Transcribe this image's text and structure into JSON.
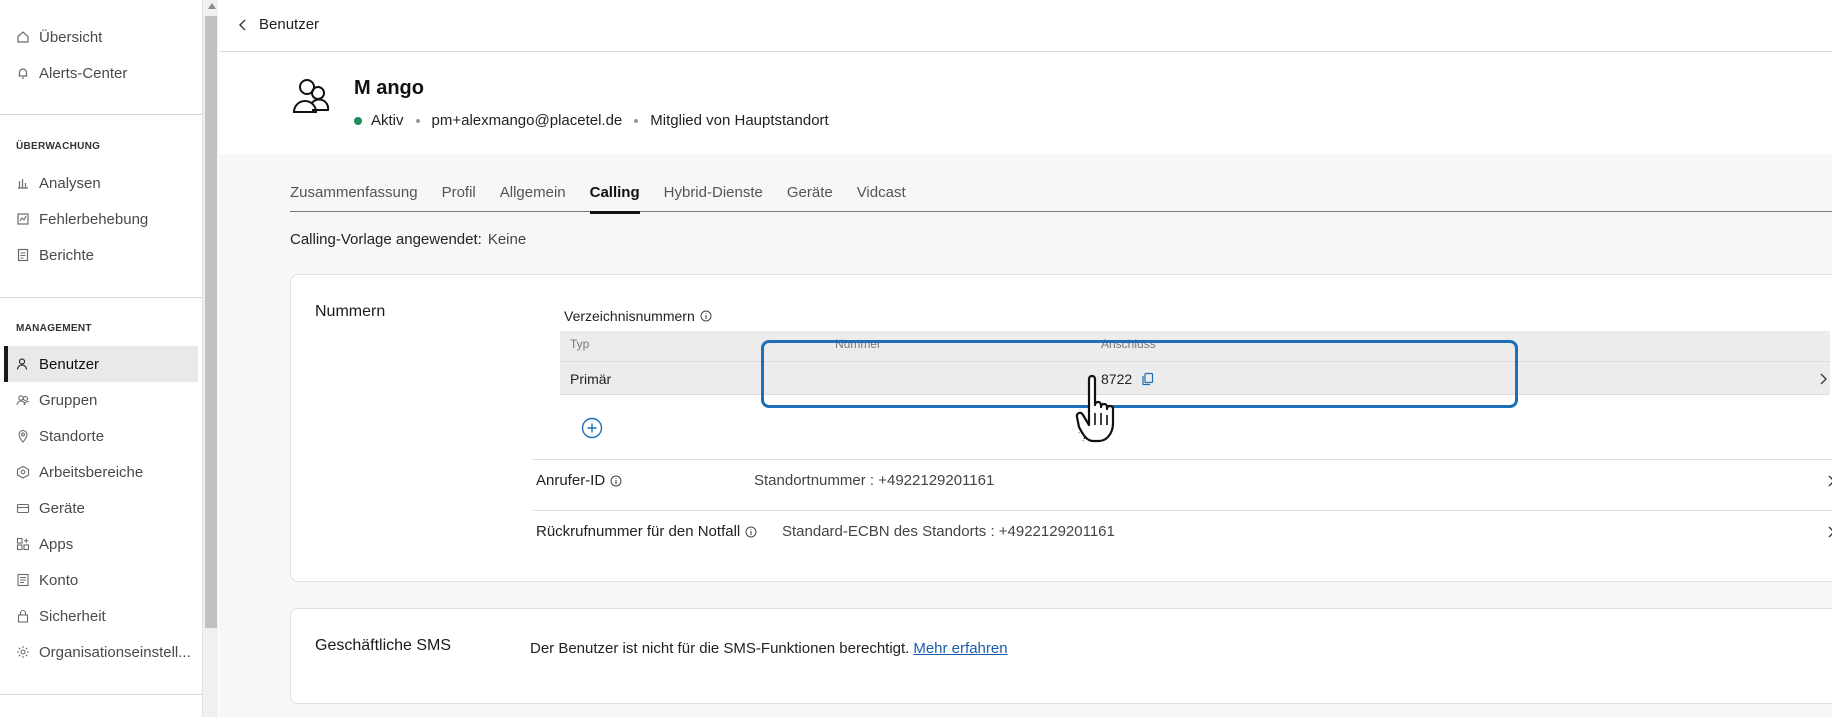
{
  "sidebar": {
    "items_top": [
      {
        "label": "Übersicht",
        "icon": "home-icon"
      },
      {
        "label": "Alerts-Center",
        "icon": "bell-icon"
      }
    ],
    "section_monitoring": "ÜBERWACHUNG",
    "items_monitoring": [
      {
        "label": "Analysen",
        "icon": "bar-chart-icon"
      },
      {
        "label": "Fehlerbehebung",
        "icon": "troubleshoot-icon"
      },
      {
        "label": "Berichte",
        "icon": "report-icon"
      }
    ],
    "section_management": "MANAGEMENT",
    "items_management": [
      {
        "label": "Benutzer",
        "icon": "user-icon",
        "active": true
      },
      {
        "label": "Gruppen",
        "icon": "group-icon"
      },
      {
        "label": "Standorte",
        "icon": "location-pin-icon"
      },
      {
        "label": "Arbeitsbereiche",
        "icon": "workspace-icon"
      },
      {
        "label": "Geräte",
        "icon": "device-icon"
      },
      {
        "label": "Apps",
        "icon": "apps-icon"
      },
      {
        "label": "Konto",
        "icon": "account-icon"
      },
      {
        "label": "Sicherheit",
        "icon": "lock-icon"
      },
      {
        "label": "Organisationseinstell...",
        "icon": "gear-icon"
      }
    ]
  },
  "topbar": {
    "back_label": "Benutzer"
  },
  "user": {
    "name": "M ango",
    "status": "Aktiv",
    "email": "pm+alexmango@placetel.de",
    "membership": "Mitglied von Hauptstandort"
  },
  "tabs": [
    "Zusammenfassung",
    "Profil",
    "Allgemein",
    "Calling",
    "Hybrid-Dienste",
    "Geräte",
    "Vidcast"
  ],
  "active_tab": "Calling",
  "template": {
    "label": "Calling-Vorlage angewendet:",
    "value": "Keine"
  },
  "numbers": {
    "title": "Nummern",
    "directory_title": "Verzeichnisnummern",
    "columns": [
      "Typ",
      "Nummer",
      "Anschluss"
    ],
    "rows": [
      {
        "type": "Primär",
        "number": "",
        "extension": "8722"
      }
    ],
    "caller_id": {
      "label": "Anrufer-ID",
      "value": "Standortnummer : +4922129201161"
    },
    "callback": {
      "label": "Rückrufnummer für den Notfall",
      "value": "Standard-ECBN des Standorts : +4922129201161"
    }
  },
  "sms": {
    "title": "Geschäftliche SMS",
    "text": "Der Benutzer ist nicht für die SMS-Funktionen berechtigt.",
    "link": "Mehr erfahren"
  },
  "colors": {
    "accent": "#1c6fb8",
    "status_active": "#1d8f5a",
    "link": "#1a5dad"
  }
}
